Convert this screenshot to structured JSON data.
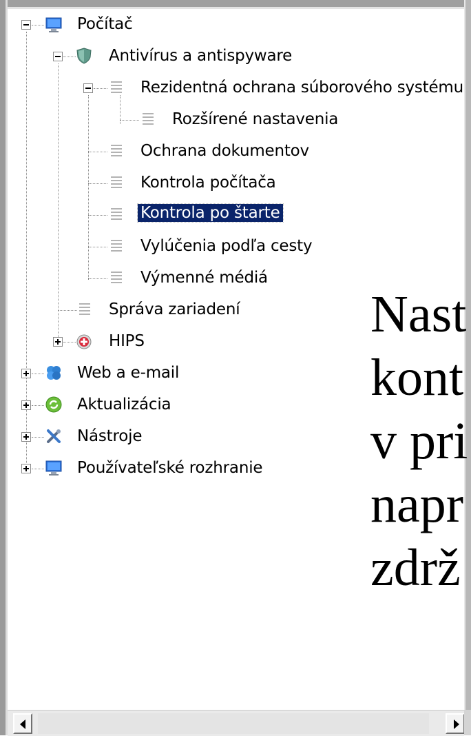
{
  "tree": {
    "items": [
      {
        "label": "Počítač",
        "icon": "monitor-icon",
        "expander": "collapse"
      },
      {
        "label": "Antivírus a antispyware",
        "icon": "shield-icon",
        "expander": "collapse"
      },
      {
        "label": "Rezidentná ochrana súborového systému",
        "icon": "page-icon",
        "expander": "collapse"
      },
      {
        "label": "Rozšírené nastavenia",
        "icon": "page-icon",
        "expander": "none"
      },
      {
        "label": "Ochrana dokumentov",
        "icon": "page-icon",
        "expander": "none"
      },
      {
        "label": "Kontrola počítača",
        "icon": "page-icon",
        "expander": "none"
      },
      {
        "label": "Kontrola po štarte",
        "icon": "page-icon",
        "expander": "none",
        "selected": true
      },
      {
        "label": "Vylúčenia podľa cesty",
        "icon": "page-icon",
        "expander": "none"
      },
      {
        "label": "Výmenné médiá",
        "icon": "page-icon",
        "expander": "none"
      },
      {
        "label": "Správa zariadení",
        "icon": "page-icon",
        "expander": "none"
      },
      {
        "label": "HIPS",
        "icon": "hips-icon",
        "expander": "expand"
      },
      {
        "label": "Web a e-mail",
        "icon": "globe-icon",
        "expander": "expand"
      },
      {
        "label": "Aktualizácia",
        "icon": "update-icon",
        "expander": "expand"
      },
      {
        "label": "Nástroje",
        "icon": "tools-icon",
        "expander": "expand"
      },
      {
        "label": "Používateľské rozhranie",
        "icon": "monitor-icon",
        "expander": "expand"
      }
    ]
  },
  "overlay_text": {
    "lines": [
      "Nast",
      "kont",
      "v pri",
      "napr",
      "zdrž"
    ]
  },
  "scrollbar": {
    "left_arrow": "left-arrow-icon",
    "right_arrow": "right-arrow-icon"
  },
  "colors": {
    "selection_bg": "#0a246a",
    "selection_text": "#ffffff"
  }
}
